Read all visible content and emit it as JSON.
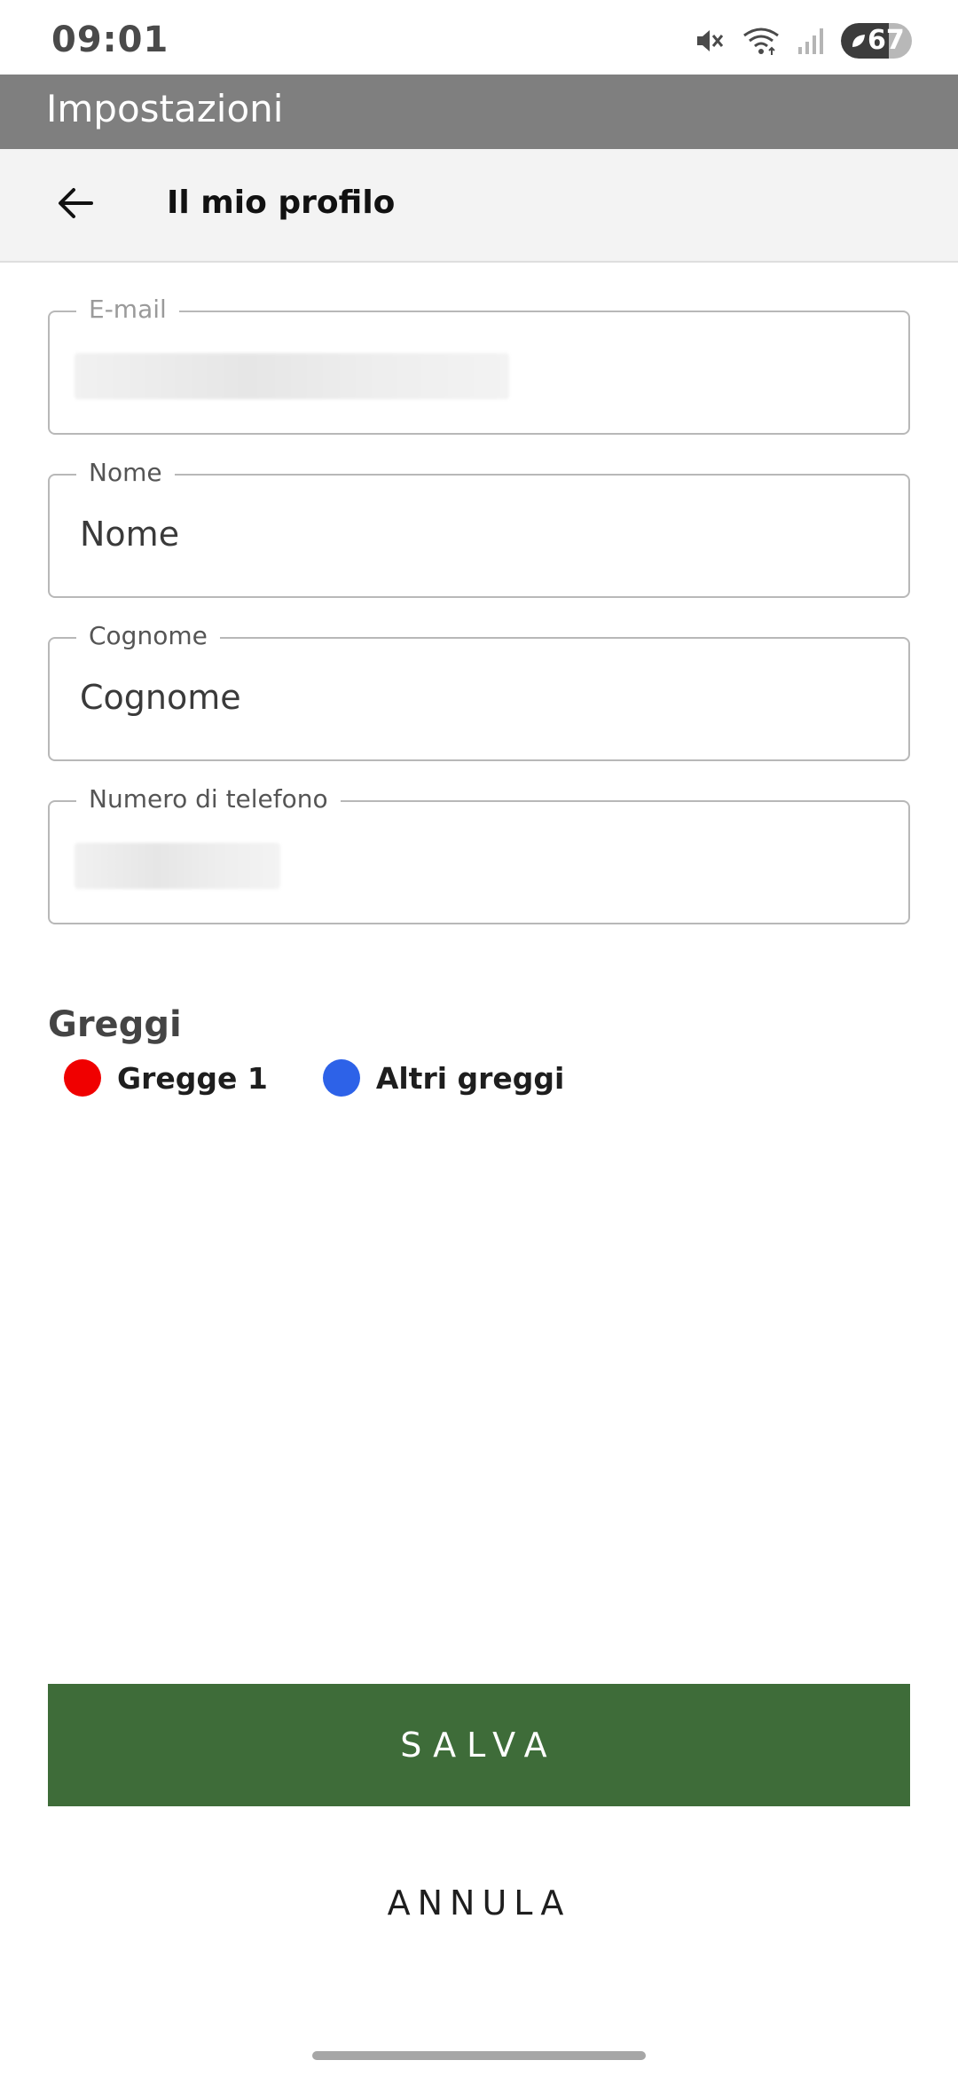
{
  "status_bar": {
    "time": "09:01",
    "battery_percent": "67",
    "battery_level": 0.67,
    "icons": [
      "mute-icon",
      "wifi-icon",
      "signal-icon",
      "battery-icon"
    ]
  },
  "app_header": {
    "title": "Impostazioni",
    "background_color": "#7f7f7f"
  },
  "sub_header": {
    "back_icon": "arrow-left-icon",
    "title": "Il mio profilo"
  },
  "form": {
    "email": {
      "label": "E-mail",
      "value": ""
    },
    "nome": {
      "label": "Nome",
      "placeholder": "Nome",
      "value": "Nome"
    },
    "cognome": {
      "label": "Cognome",
      "placeholder": "Cognome",
      "value": "Cognome"
    },
    "telefono": {
      "label": "Numero di telefono",
      "value": ""
    }
  },
  "greggi": {
    "title": "Greggi",
    "items": [
      {
        "label": "Gregge 1",
        "color": "#f00000"
      },
      {
        "label": "Altri greggi",
        "color": "#2d62e8"
      }
    ]
  },
  "actions": {
    "save_label": "SALVA",
    "save_color": "#3e6c39",
    "cancel_label": "ANNULA"
  }
}
